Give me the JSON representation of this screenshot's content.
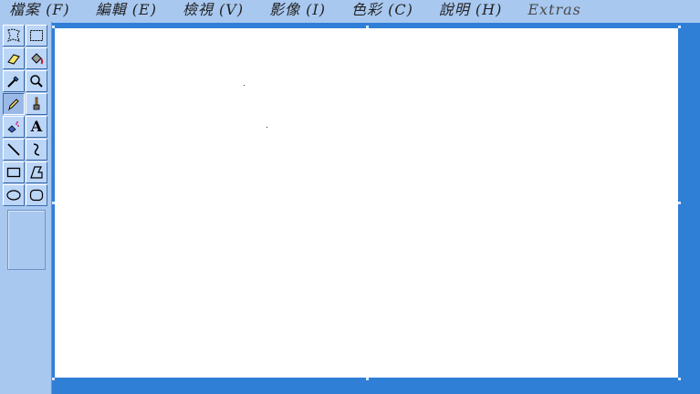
{
  "menu": [
    {
      "label": "檔案 (F)"
    },
    {
      "label": "編輯 (E)"
    },
    {
      "label": "檢視 (V)"
    },
    {
      "label": "影像 (I)"
    },
    {
      "label": "色彩 (C)"
    },
    {
      "label": "說明 (H)"
    },
    {
      "label": "Extras"
    }
  ],
  "tools": [
    {
      "name": "free-form-select-icon",
      "active": false
    },
    {
      "name": "select-icon",
      "active": false
    },
    {
      "name": "eraser-icon",
      "active": false
    },
    {
      "name": "fill-bucket-icon",
      "active": false
    },
    {
      "name": "color-picker-icon",
      "active": false
    },
    {
      "name": "magnifier-icon",
      "active": false
    },
    {
      "name": "pencil-icon",
      "active": true
    },
    {
      "name": "brush-icon",
      "active": false
    },
    {
      "name": "airbrush-icon",
      "active": false
    },
    {
      "name": "text-icon",
      "active": false
    },
    {
      "name": "line-icon",
      "active": false
    },
    {
      "name": "curve-icon",
      "active": false
    },
    {
      "name": "rectangle-icon",
      "active": false
    },
    {
      "name": "polygon-icon",
      "active": false
    },
    {
      "name": "ellipse-icon",
      "active": false
    },
    {
      "name": "rounded-rectangle-icon",
      "active": false
    }
  ],
  "text_tool_glyph": "A",
  "colors": {
    "chrome": "#a8c8f0",
    "workspace": "#2f7fd7",
    "canvas": "#ffffff"
  }
}
